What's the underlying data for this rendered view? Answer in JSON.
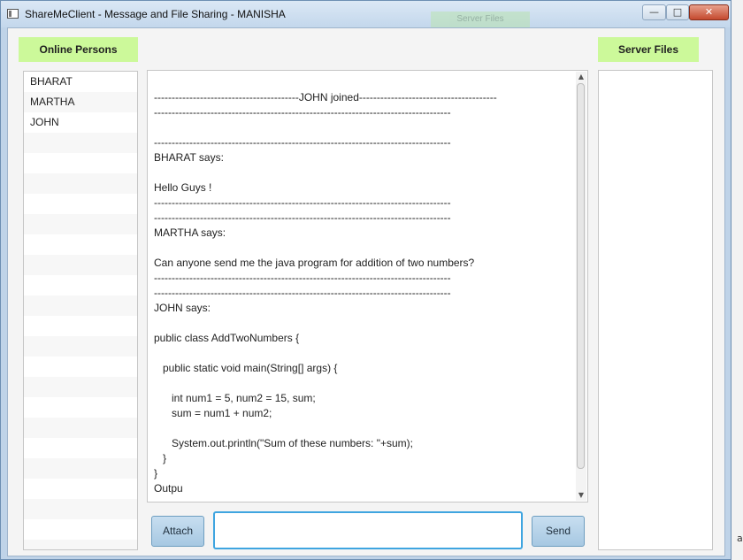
{
  "window": {
    "title": "ShareMeClient - Message and File Sharing - MANISHA",
    "controls": {
      "minimize": "—",
      "maximize": "□",
      "close": "✕"
    },
    "background_tab_label": "Server Files"
  },
  "online_persons": {
    "label": "Online Persons",
    "items": [
      "BHARAT",
      "MARTHA",
      "JOHN"
    ]
  },
  "server_files": {
    "label": "Server Files",
    "items": []
  },
  "chat": {
    "transcript": "-----------------------------------------JOHN joined---------------------------------------\n------------------------------------------------------------------------------------\n\n------------------------------------------------------------------------------------\nBHARAT says:\n\nHello Guys !\n------------------------------------------------------------------------------------\n------------------------------------------------------------------------------------\nMARTHA says:\n\nCan anyone send me the java program for addition of two numbers?\n------------------------------------------------------------------------------------\n------------------------------------------------------------------------------------\nJOHN says:\n\npublic class AddTwoNumbers {\n\n   public static void main(String[] args) {\n\n      int num1 = 5, num2 = 15, sum;\n      sum = num1 + num2;\n\n      System.out.println(\"Sum of these numbers: \"+sum);\n   }\n}\nOutpu"
  },
  "composer": {
    "attach_label": "Attach",
    "send_label": "Send",
    "input_value": ""
  },
  "colors": {
    "label_bg": "#ccf99a",
    "input_focus": "#3fa5e0",
    "button_bg": "#a7c8e2"
  }
}
